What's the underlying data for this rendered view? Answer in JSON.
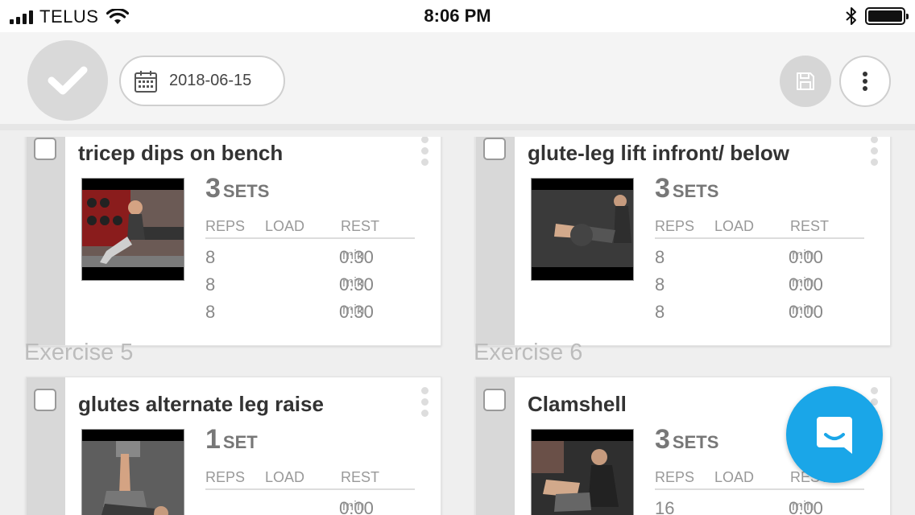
{
  "status_bar": {
    "carrier": "TELUS",
    "time": "8:06 PM"
  },
  "toolbar": {
    "date": "2018-06-15"
  },
  "labels": {
    "reps": "REPS",
    "load": "LOAD",
    "rest": "REST",
    "min": "min"
  },
  "sections": [
    {
      "label": "Exercise 5"
    },
    {
      "label": "Exercise 6"
    }
  ],
  "cards": [
    {
      "title": "tricep dips on bench",
      "sets_count": "3",
      "sets_unit": "SETS",
      "rows": [
        {
          "reps": "8",
          "rest": "0:30"
        },
        {
          "reps": "8",
          "rest": "0:30"
        },
        {
          "reps": "8",
          "rest": "0:30"
        }
      ]
    },
    {
      "title": "glute-leg lift infront/ below",
      "sets_count": "3",
      "sets_unit": "SETS",
      "rows": [
        {
          "reps": "8",
          "rest": "0:00"
        },
        {
          "reps": "8",
          "rest": "0:00"
        },
        {
          "reps": "8",
          "rest": "0:00"
        }
      ]
    },
    {
      "title": "glutes alternate leg raise",
      "sets_count": "1",
      "sets_unit": "SET",
      "rows": [
        {
          "reps": "",
          "rest": "0:00"
        }
      ]
    },
    {
      "title": "Clamshell",
      "sets_count": "3",
      "sets_unit": "SETS",
      "rows": [
        {
          "reps": "16",
          "rest": "0:00"
        }
      ]
    }
  ],
  "colors": {
    "fab": "#1aa6e8",
    "stripe": "#d8d8d8",
    "toolbar": "#f4f4f4"
  }
}
